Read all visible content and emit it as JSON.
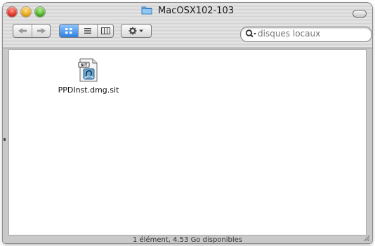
{
  "window": {
    "title": "MacOSX102-103",
    "folder_icon": "folder-icon"
  },
  "toolbar": {
    "back_icon": "back-arrow-icon",
    "forward_icon": "forward-arrow-icon",
    "view_icons": [
      "icon-view-icon",
      "list-view-icon",
      "column-view-icon"
    ],
    "selected_view": "icon-view-icon",
    "action_icon": "gear-icon"
  },
  "search": {
    "placeholder": "disques locaux",
    "icon": "search-icon"
  },
  "files": [
    {
      "name": "PPDInst.dmg.sit",
      "icon": "stuffit-archive-icon"
    }
  ],
  "status": {
    "text": "1 élément, 4.53 Go disponibles"
  },
  "colors": {
    "close": "#e0352a",
    "minimize": "#e8a81d",
    "zoom": "#4fb12c",
    "selected_view": "#3b8ef0"
  }
}
